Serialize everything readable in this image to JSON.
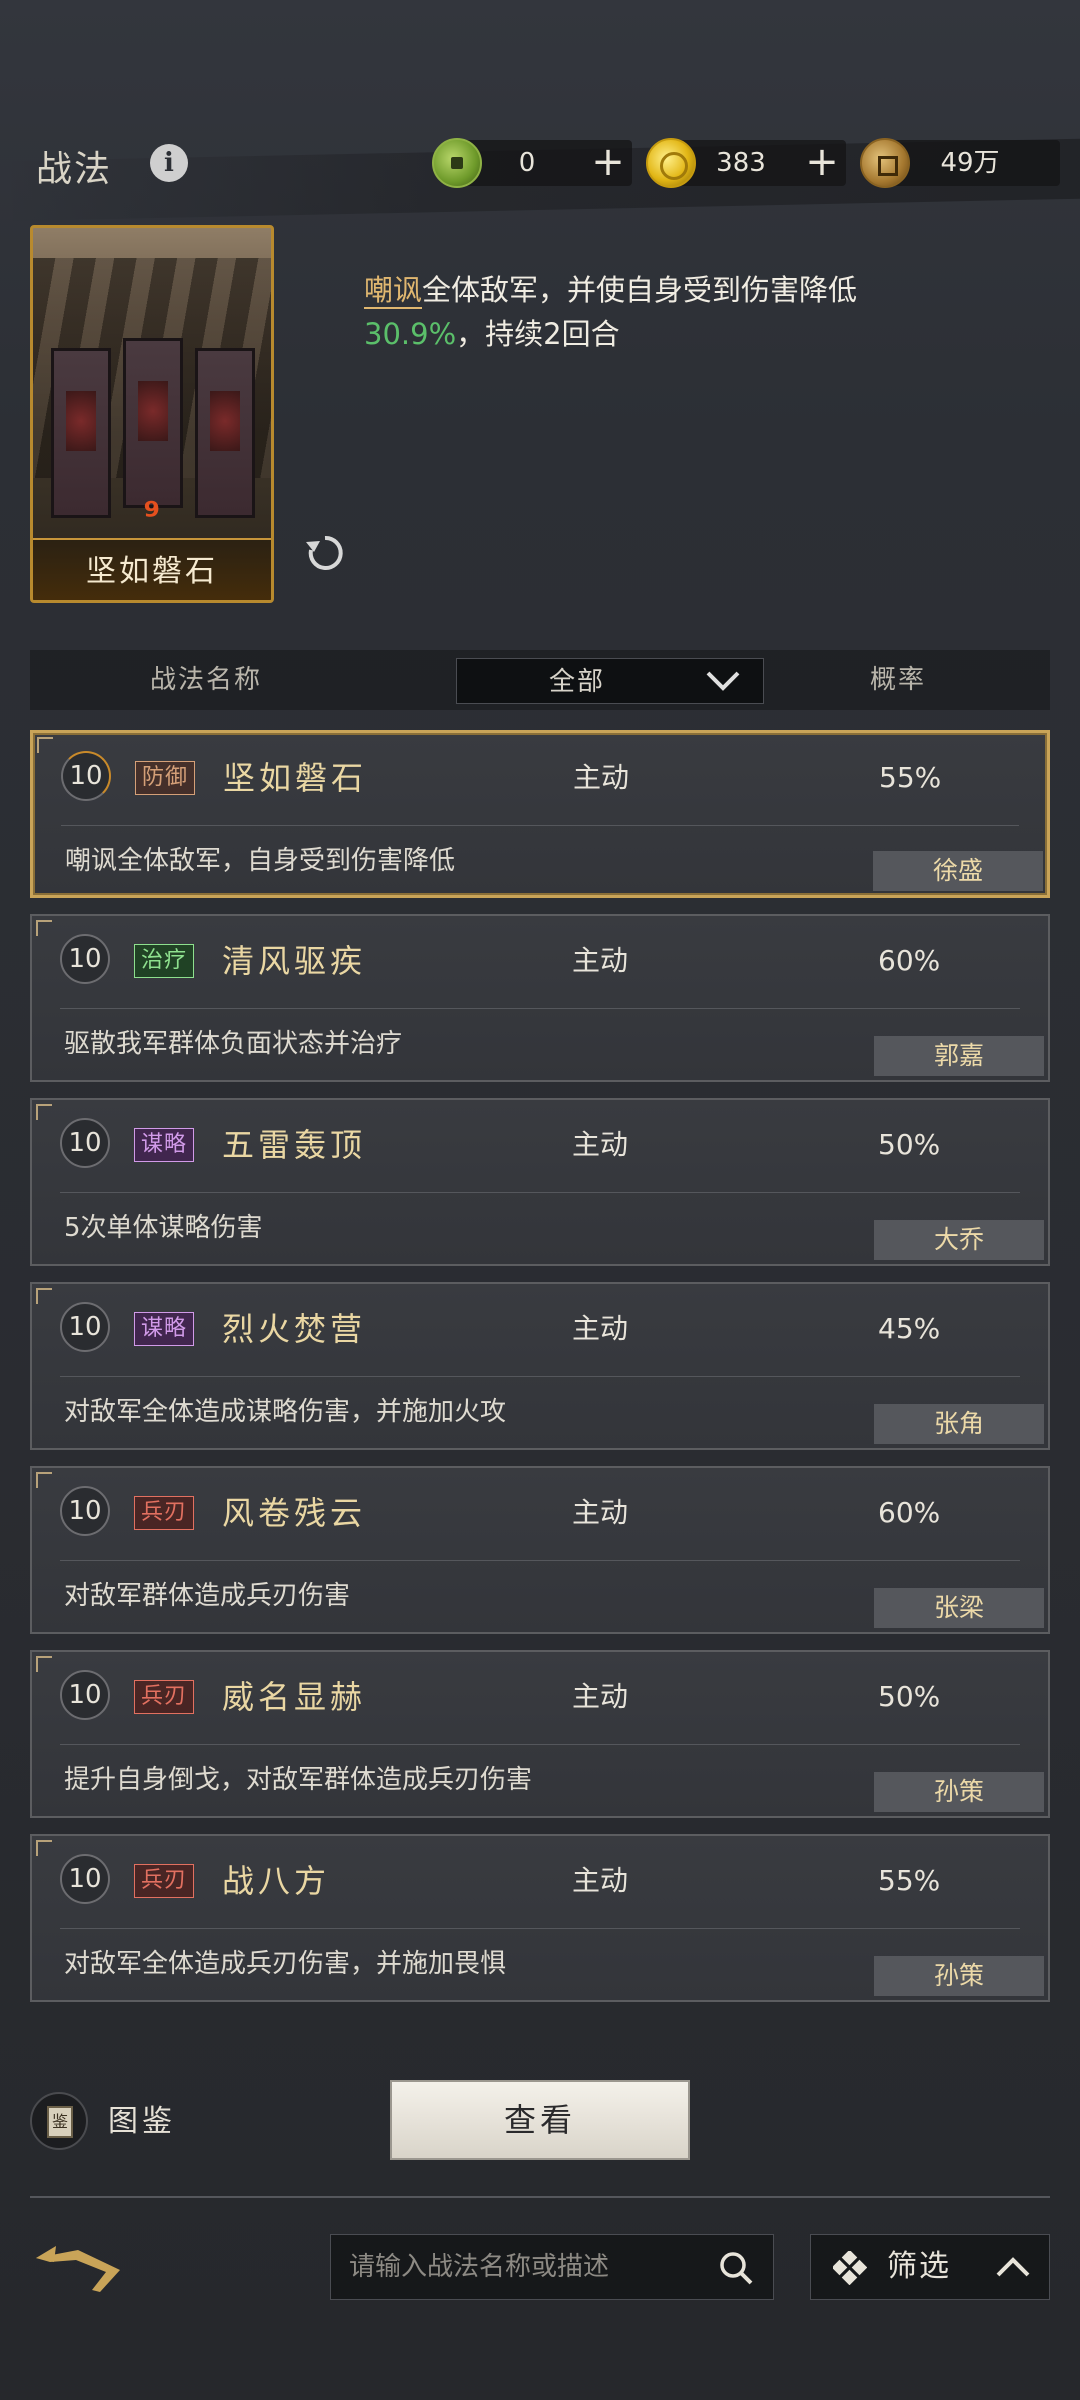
{
  "header": {
    "title": "战法",
    "resources": [
      {
        "name": "jade",
        "icon": "jade-coin-icon",
        "value": "0",
        "has_plus": true
      },
      {
        "name": "gold",
        "icon": "gold-coin-icon",
        "value": "383",
        "has_plus": true
      },
      {
        "name": "copper",
        "icon": "copper-coin-icon",
        "value": "49万",
        "has_plus": false
      }
    ],
    "plus_label": "+"
  },
  "detail": {
    "card_name": "坚如磐石",
    "card_mark": "🈀",
    "desc_keyword": "嘲讽",
    "desc_part1": "全体敌军，并使自身受到伤害降低",
    "desc_number": "30.9%",
    "desc_part2": "，持续2回合"
  },
  "table": {
    "col_name": "战法名称",
    "filter_value": "全部",
    "col_prob": "概率"
  },
  "skills": [
    {
      "level": "10",
      "tag": "防御",
      "tag_type": "def",
      "name": "坚如磐石",
      "type": "主动",
      "prob": "55%",
      "effect": "嘲讽全体敌军，自身受到伤害降低",
      "general": "徐盛",
      "selected": true
    },
    {
      "level": "10",
      "tag": "治疗",
      "tag_type": "heal",
      "name": "清风驱疾",
      "type": "主动",
      "prob": "60%",
      "effect": "驱散我军群体负面状态并治疗",
      "general": "郭嘉",
      "selected": false
    },
    {
      "level": "10",
      "tag": "谋略",
      "tag_type": "str",
      "name": "五雷轰顶",
      "type": "主动",
      "prob": "50%",
      "effect": "5次单体谋略伤害",
      "general": "大乔",
      "selected": false
    },
    {
      "level": "10",
      "tag": "谋略",
      "tag_type": "str",
      "name": "烈火焚营",
      "type": "主动",
      "prob": "45%",
      "effect": "对敌军全体造成谋略伤害，并施加火攻",
      "general": "张角",
      "selected": false
    },
    {
      "level": "10",
      "tag": "兵刃",
      "tag_type": "blade",
      "name": "风卷残云",
      "type": "主动",
      "prob": "60%",
      "effect": "对敌军群体造成兵刃伤害",
      "general": "张梁",
      "selected": false
    },
    {
      "level": "10",
      "tag": "兵刃",
      "tag_type": "blade",
      "name": "威名显赫",
      "type": "主动",
      "prob": "50%",
      "effect": "提升自身倒戈，对敌军群体造成兵刃伤害",
      "general": "孙策",
      "selected": false
    },
    {
      "level": "10",
      "tag": "兵刃",
      "tag_type": "blade",
      "name": "战八方",
      "type": "主动",
      "prob": "55%",
      "effect": "对敌军全体造成兵刃伤害，并施加畏惧",
      "general": "孙策",
      "selected": false
    }
  ],
  "bottom": {
    "atlas_label": "图鉴",
    "atlas_book_char": "鉴",
    "view_button": "查看",
    "search_placeholder": "请输入战法名称或描述",
    "filter_label": "筛选"
  }
}
